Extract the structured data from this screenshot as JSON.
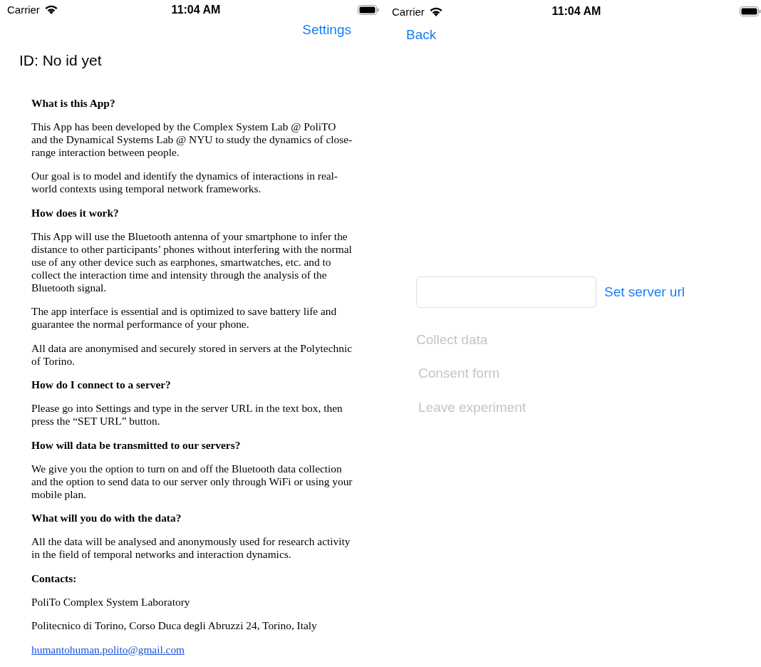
{
  "screens": [
    {
      "status_bar": {
        "carrier": "Carrier",
        "time": "11:04 AM"
      },
      "nav": {
        "button": "Settings"
      },
      "id_label": "ID: No id yet",
      "content": [
        {
          "kind": "heading",
          "text": "What is this App?"
        },
        {
          "kind": "paragraph",
          "text": "This App has been developed by the Complex System Lab @ PoliTO and the Dynamical Systems Lab @ NYU to study the dynamics of close-range interaction between people."
        },
        {
          "kind": "paragraph",
          "text": "Our goal is to model and identify the dynamics of interactions in real-world contexts using temporal network frameworks."
        },
        {
          "kind": "heading",
          "text": "How does it work?"
        },
        {
          "kind": "paragraph",
          "text": "This App will use the Bluetooth antenna of your smartphone to infer the distance to other participants’ phones without interfering with the normal use of any other device such as earphones, smartwatches, etc. and to collect the interaction time and intensity through the analysis of the Bluetooth signal."
        },
        {
          "kind": "paragraph",
          "text": "The app interface is essential and is optimized to save battery life and guarantee the normal performance of your phone."
        },
        {
          "kind": "paragraph",
          "text": "All data are anonymised and securely stored in servers at the Polytechnic of Torino."
        },
        {
          "kind": "heading",
          "text": "How do I connect to a server?"
        },
        {
          "kind": "paragraph",
          "text": "Please go into Settings and type in the server URL in the text box, then press the “SET URL” button."
        },
        {
          "kind": "heading",
          "text": "How will data be transmitted to our servers?"
        },
        {
          "kind": "paragraph",
          "text": "We give you the option to turn on and off the Bluetooth data collection and the option to send data to our server only through WiFi or using your mobile plan."
        },
        {
          "kind": "heading",
          "text": "What will you do with the data?"
        },
        {
          "kind": "paragraph",
          "text": "All the data will be analysed and anonymously used for research activity in the field of temporal networks and interaction dynamics."
        },
        {
          "kind": "heading",
          "text": "Contacts:"
        },
        {
          "kind": "paragraph",
          "text": "PoliTo Complex System Laboratory"
        },
        {
          "kind": "paragraph",
          "text": "Politecnico di Torino, Corso Duca degli Abruzzi 24, Torino, Italy"
        },
        {
          "kind": "link",
          "text": "humantohuman.polito@gmail.com"
        }
      ]
    },
    {
      "status_bar": {
        "carrier": "Carrier",
        "time": "11:04 AM"
      },
      "nav": {
        "button": "Back"
      },
      "server_row": {
        "button": "Set server url"
      },
      "actions": [
        {
          "label": "Collect data",
          "disabled": true
        },
        {
          "label": "Consent form",
          "disabled": true
        },
        {
          "label": "Leave experiment",
          "disabled": true
        }
      ]
    }
  ]
}
